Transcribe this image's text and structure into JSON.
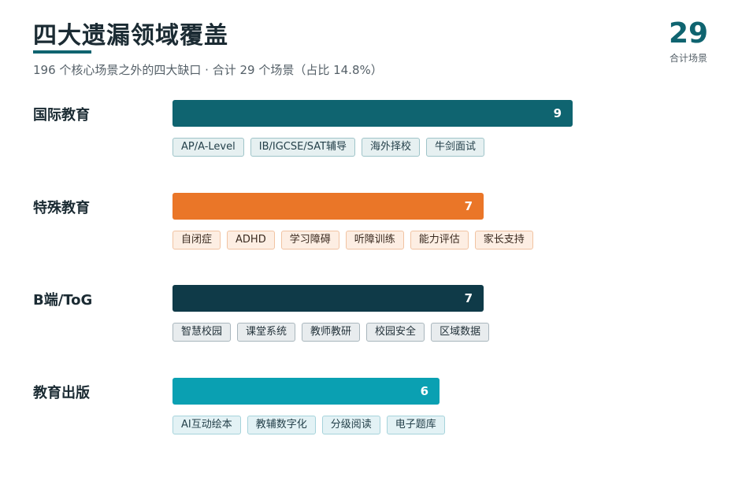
{
  "header": {
    "title": "四大遗漏领域覆盖",
    "subtitle": "196 个核心场景之外的四大缺口 · 合计 29 个场景（占比 14.8%）",
    "total_number": "29",
    "total_label": "合计场景"
  },
  "colors": {
    "teal": "#0f6470",
    "orange": "#ea7628",
    "dark": "#0f3a48",
    "cyan": "#0aa0b2"
  },
  "chart_data": {
    "type": "bar",
    "orientation": "horizontal",
    "title": "四大遗漏领域覆盖",
    "categories": [
      "国际教育",
      "特殊教育",
      "B端/ToG",
      "教育出版"
    ],
    "values": [
      9,
      7,
      7,
      6
    ],
    "xlim": [
      0,
      12.5
    ],
    "grid": false,
    "groups": [
      {
        "label": "国际教育",
        "value": 9,
        "color": "#0f6470",
        "tag_style": "teal",
        "tags": [
          "AP/A-Level",
          "IB/IGCSE/SAT辅导",
          "海外择校",
          "牛剑面试"
        ]
      },
      {
        "label": "特殊教育",
        "value": 7,
        "color": "#ea7628",
        "tag_style": "orange",
        "tags": [
          "自闭症",
          "ADHD",
          "学习障碍",
          "听障训练",
          "能力评估",
          "家长支持"
        ]
      },
      {
        "label": "B端/ToG",
        "value": 7,
        "color": "#0f3a48",
        "tag_style": "dark",
        "tags": [
          "智慧校园",
          "课堂系统",
          "教师教研",
          "校园安全",
          "区域数据"
        ]
      },
      {
        "label": "教育出版",
        "value": 6,
        "color": "#0aa0b2",
        "tag_style": "cyan",
        "tags": [
          "AI互动绘本",
          "教辅数字化",
          "分级阅读",
          "电子题库"
        ]
      }
    ]
  }
}
